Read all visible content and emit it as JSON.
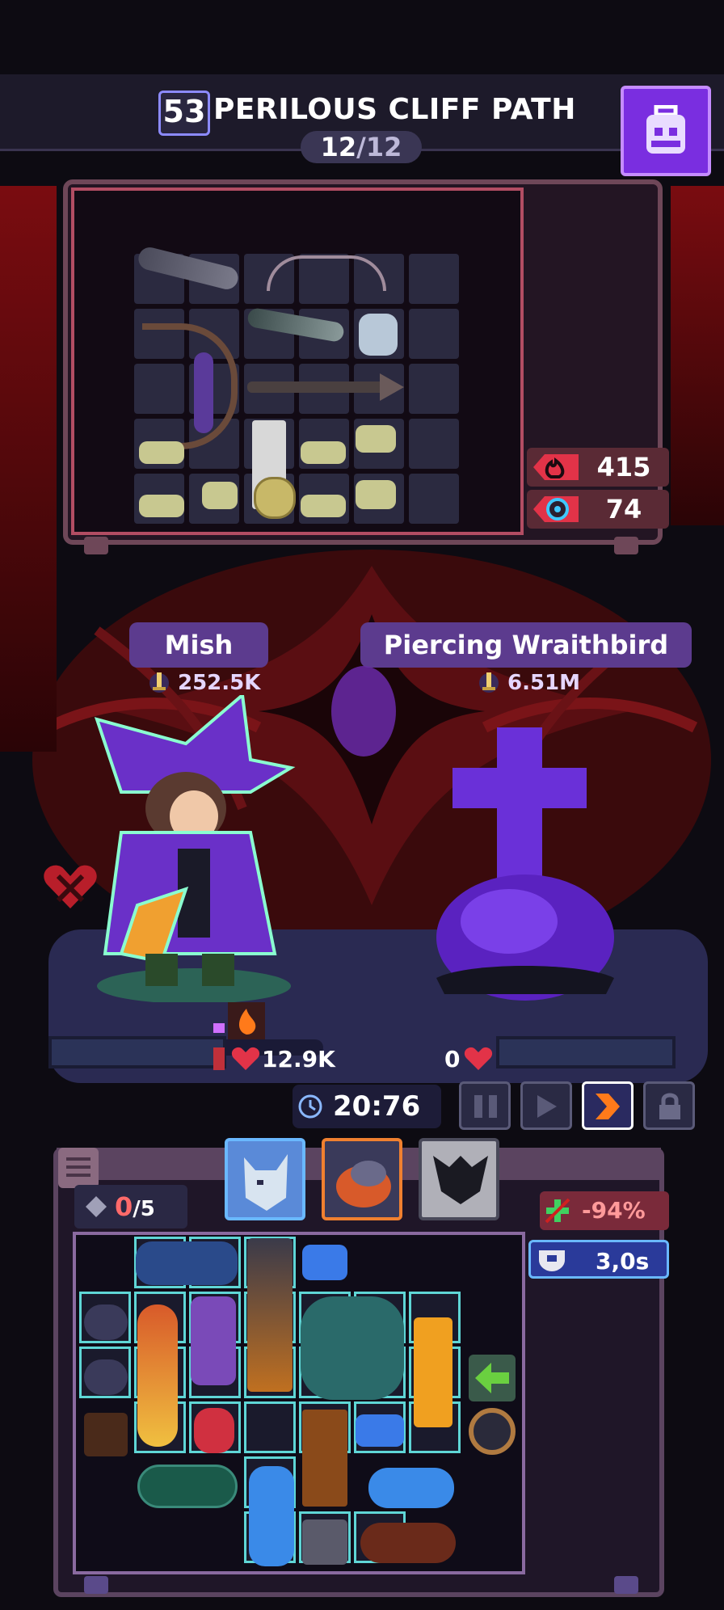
{
  "header": {
    "level": "53",
    "stage_title": "PERILOUS CLIFF PATH",
    "wave_current": "12",
    "wave_total": "/12"
  },
  "enemy_stats": {
    "attack": "415",
    "defense": "74"
  },
  "player": {
    "name": "Mish",
    "power": "252.5K",
    "hp": "12.9K"
  },
  "enemy": {
    "name": "Piercing Wraithbird",
    "power": "6.51M",
    "hp": "0"
  },
  "battle": {
    "timer": "20:76"
  },
  "hero_bag": {
    "slots_used": "0",
    "slots_total": "/5",
    "stat_reduction": "-94%",
    "cooldown": "3,0s"
  },
  "icons": [
    "bag-icon",
    "flame-icon",
    "gear-icon",
    "dagger-icon",
    "heart-icon",
    "clock-icon",
    "pause-icon",
    "play-icon",
    "fast-forward-icon",
    "lock-icon",
    "menu-icon",
    "diamond-icon",
    "shield-icon",
    "wolf-icon"
  ],
  "colors": {
    "accent_purple": "#7a2ee0",
    "hp_red": "#e23348",
    "cyan_highlight": "#5fd6d6",
    "fast_forward_orange": "#ff7a1a"
  }
}
